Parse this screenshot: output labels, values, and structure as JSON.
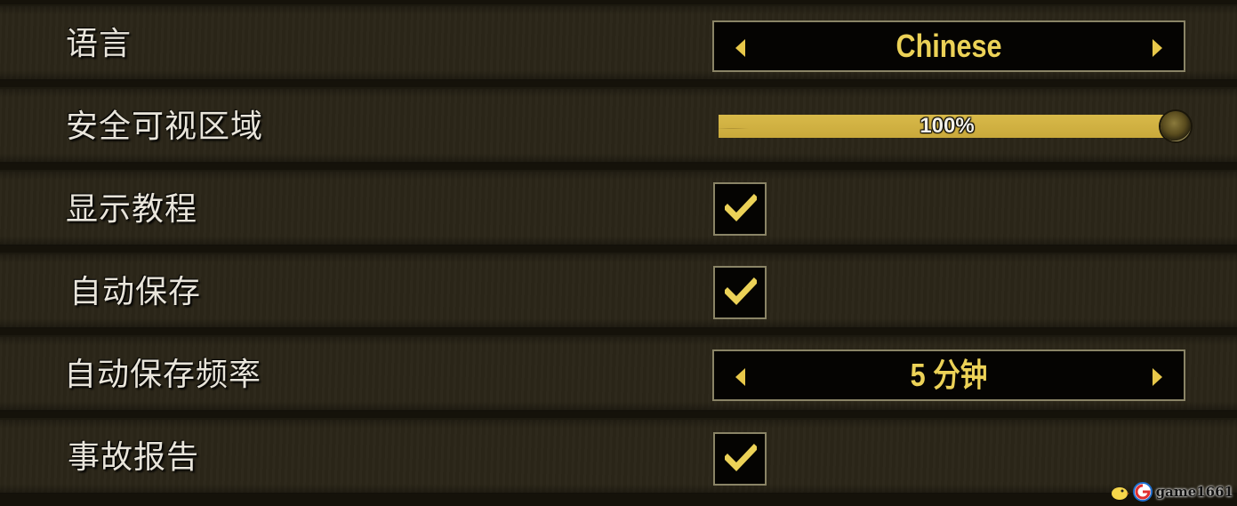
{
  "settings": {
    "language": {
      "label": "语言",
      "value": "Chinese"
    },
    "safe_area": {
      "label": "安全可视区域",
      "value_text": "100%",
      "value": 1.0
    },
    "show_tutorial": {
      "label": "显示教程",
      "checked": true
    },
    "autosave": {
      "label": "自动保存",
      "checked": true
    },
    "autosave_frequency": {
      "label": "自动保存频率",
      "value": "5 分钟"
    },
    "crash_report": {
      "label": "事故报告",
      "checked": true
    }
  },
  "watermark": {
    "text": "game1661"
  },
  "colors": {
    "accent": "#ecd257",
    "row_bg": "#2b2618",
    "box_border": "#8a8466",
    "box_bg": "#050402"
  },
  "icons": {
    "arrow_left": "caret-left-icon",
    "arrow_right": "caret-right-icon",
    "check": "checkmark-icon"
  }
}
